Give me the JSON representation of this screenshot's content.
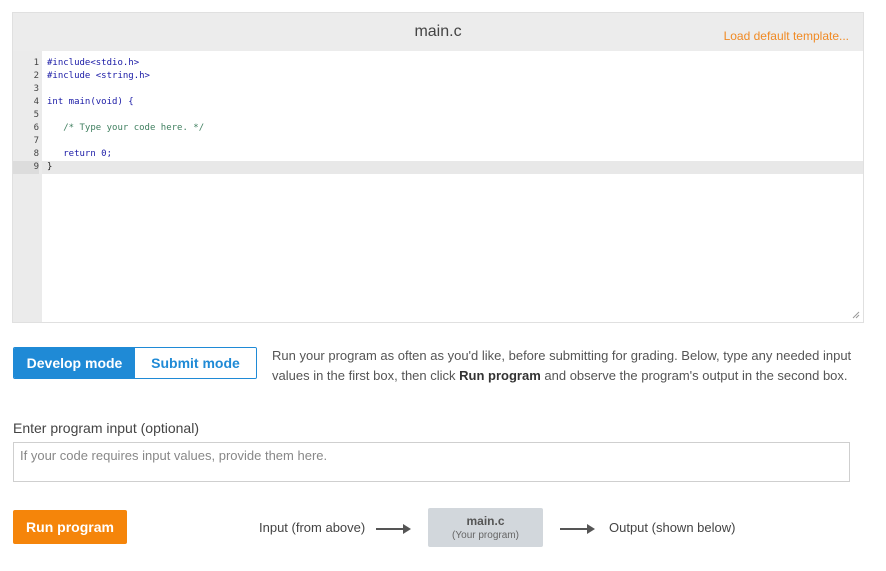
{
  "editor": {
    "filename": "main.c",
    "load_template_link": "Load default template...",
    "lines": [
      {
        "num": "1",
        "text": "#include<stdio.h>"
      },
      {
        "num": "2",
        "text": "#include <string.h>"
      },
      {
        "num": "3",
        "text": ""
      },
      {
        "num": "4",
        "text": "int main(void) {"
      },
      {
        "num": "5",
        "text": ""
      },
      {
        "num": "6",
        "text": "   /* Type your code here. */"
      },
      {
        "num": "7",
        "text": ""
      },
      {
        "num": "8",
        "text": "   return 0;"
      },
      {
        "num": "9",
        "text": "}"
      }
    ],
    "active_line": "9"
  },
  "mode": {
    "develop_label": "Develop mode",
    "submit_label": "Submit mode",
    "selected": "Develop mode",
    "description_part1": "Run your program as often as you'd like, before submitting for grading. Below, type any needed input values in the first box, then click ",
    "description_bold": "Run program",
    "description_part2": " and observe the program's output in the second box."
  },
  "input": {
    "label": "Enter program input (optional)",
    "placeholder": "If your code requires input values, provide them here.",
    "value": ""
  },
  "run": {
    "button_label": "Run program",
    "flow_input_label": "Input (from above)",
    "program_name": "main.c",
    "program_sub": "(Your program)",
    "flow_output_label": "Output (shown below)"
  },
  "colors": {
    "accent_blue": "#1f8ad6",
    "accent_orange": "#f5850a",
    "link_orange": "#f08a24"
  }
}
